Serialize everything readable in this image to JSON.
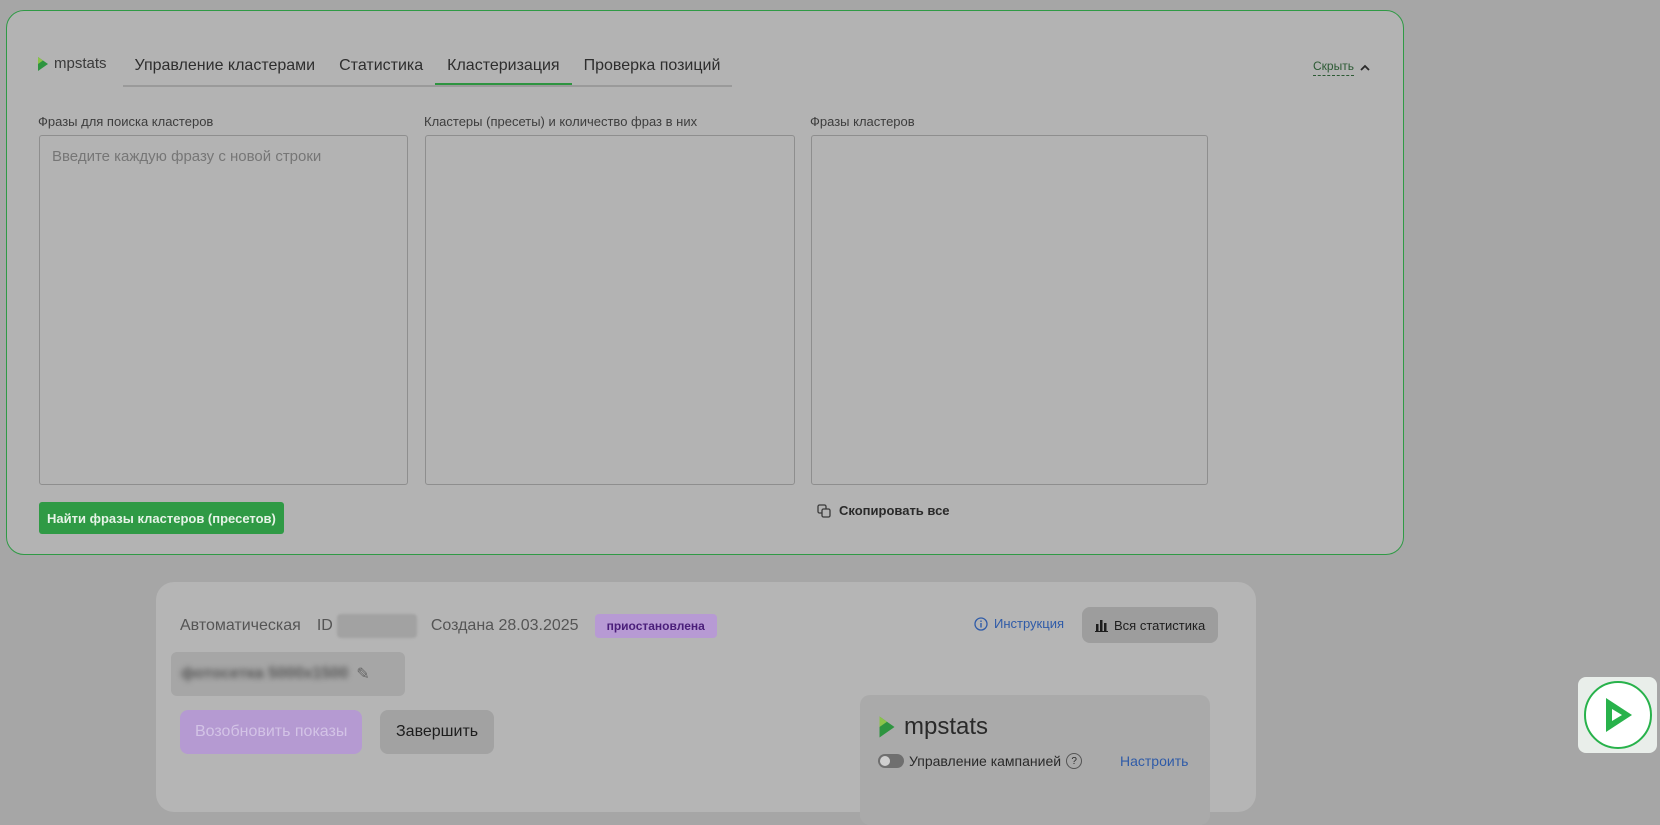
{
  "nav": {
    "logo": "mpstats",
    "tabs": [
      "Управление кластерами",
      "Статистика",
      "Кластеризация",
      "Проверка позиций"
    ],
    "active_tab": "Кластеризация",
    "hide_label": "Скрыть"
  },
  "clustering": {
    "phrases_label": "Фразы для поиска кластеров",
    "phrases_placeholder": "Введите каждую фразу с новой строки",
    "clusters_label": "Кластеры (пресеты) и количество фраз в них",
    "cluster_phrases_label": "Фразы кластеров",
    "find_button": "Найти фразы кластеров (пресетов)",
    "copy_all": "Скопировать все"
  },
  "campaign": {
    "type": "Автоматическая",
    "id_label": "ID",
    "created": "Создана 28.03.2025",
    "status": "приостановлена",
    "instruction": "Инструкция",
    "all_stats": "Вся статистика",
    "name": "фотосетка 5000x1500",
    "resume_button": "Возобновить показы",
    "finish_button": "Завершить",
    "mpstats_logo": "mpstats",
    "campaign_control": "Управление кампанией",
    "configure": "Настроить"
  },
  "colors": {
    "accent": "#2f9a45",
    "status_badge": "#b79ad4",
    "link": "#2f5ba8"
  }
}
